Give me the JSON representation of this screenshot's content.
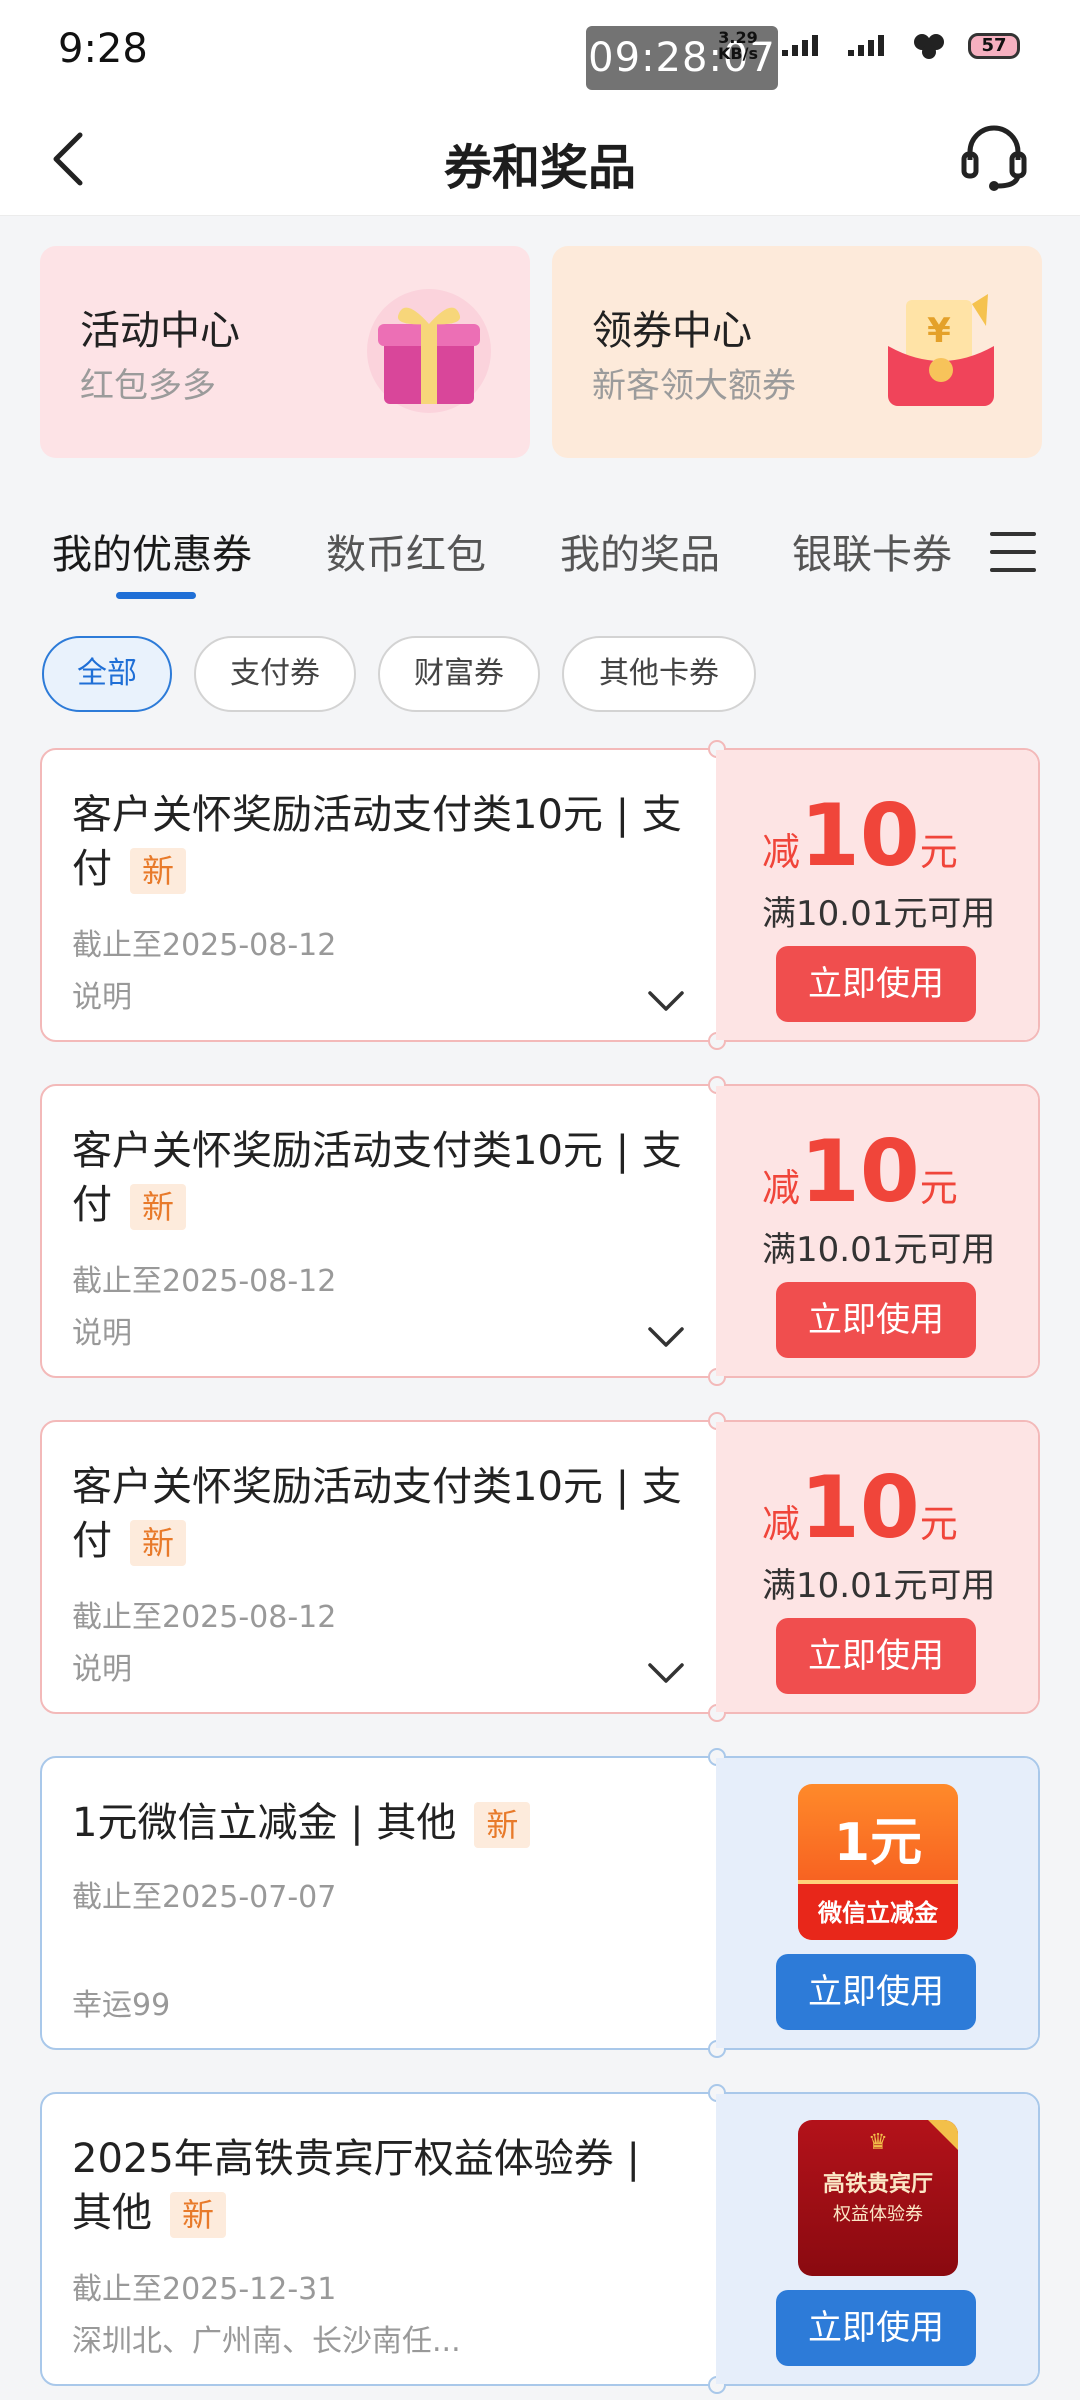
{
  "status_bar": {
    "time": "9:28",
    "clock_overlay": "09:28:07",
    "net_speed_value": "3.29",
    "net_speed_unit": "KB/s",
    "battery": "57"
  },
  "nav": {
    "title": "券和奖品"
  },
  "banners": [
    {
      "title": "活动中心",
      "subtitle": "红包多多"
    },
    {
      "title": "领券中心",
      "subtitle": "新客领大额券"
    }
  ],
  "tabs": [
    {
      "label": "我的优惠券",
      "active": true
    },
    {
      "label": "数币红包",
      "active": false
    },
    {
      "label": "我的奖品",
      "active": false
    },
    {
      "label": "银联卡券",
      "active": false
    }
  ],
  "filters": [
    {
      "label": "全部",
      "active": true
    },
    {
      "label": "支付券",
      "active": false
    },
    {
      "label": "财富券",
      "active": false
    },
    {
      "label": "其他卡券",
      "active": false
    }
  ],
  "coupons": [
    {
      "theme": "red",
      "title": "客户关怀奖励活动支付类10元 | 支付",
      "tag": "新",
      "date": "截止至2025-08-12",
      "note": "说明",
      "prefix": "减",
      "amount": "10",
      "unit": "元",
      "condition": "满10.01元可用",
      "button": "立即使用"
    },
    {
      "theme": "red",
      "title": "客户关怀奖励活动支付类10元 | 支付",
      "tag": "新",
      "date": "截止至2025-08-12",
      "note": "说明",
      "prefix": "减",
      "amount": "10",
      "unit": "元",
      "condition": "满10.01元可用",
      "button": "立即使用"
    },
    {
      "theme": "red",
      "title": "客户关怀奖励活动支付类10元 | 支付",
      "tag": "新",
      "date": "截止至2025-08-12",
      "note": "说明",
      "prefix": "减",
      "amount": "10",
      "unit": "元",
      "condition": "满10.01元可用",
      "button": "立即使用"
    },
    {
      "theme": "blue",
      "title": "1元微信立减金 | 其他",
      "tag": "新",
      "date": "截止至2025-07-07",
      "note": "幸运99",
      "image_big": "1元",
      "image_small": "微信立减金",
      "button": "立即使用"
    },
    {
      "theme": "blue",
      "title": "2025年高铁贵宾厅权益体验券 | 其他",
      "tag": "新",
      "date": "截止至2025-12-31",
      "note": "深圳北、广州南、长沙南任...",
      "image_line1": "高铁贵宾厅",
      "image_line2": "权益体验券",
      "button": "立即使用"
    }
  ],
  "colors": {
    "accent_blue": "#1f6fd6",
    "coupon_red": "#f04e4e",
    "tag_orange": "#e87a2a"
  }
}
